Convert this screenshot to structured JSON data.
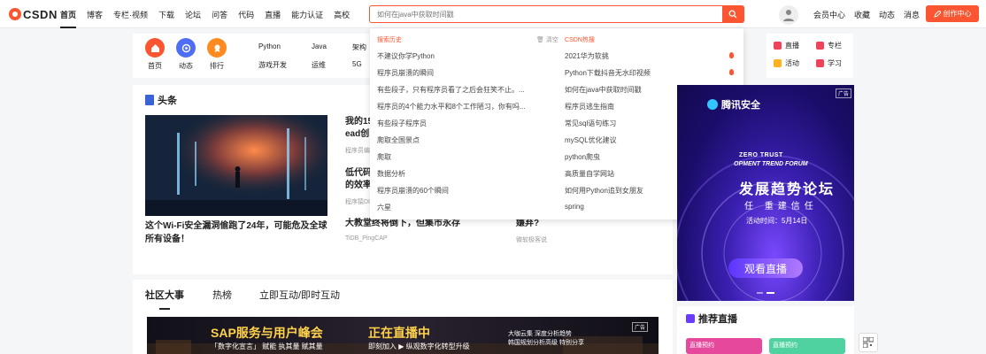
{
  "logo": {
    "text": "CSDN"
  },
  "nav": [
    "首页",
    "博客",
    "专栏·视频",
    "下载",
    "论坛",
    "问答",
    "代码",
    "直播",
    "能力认证",
    "高校"
  ],
  "search": {
    "placeholder": "如何在java中获取时间戳"
  },
  "top_links": [
    "会员中心",
    "收藏",
    "动态",
    "消息"
  ],
  "create_label": "创作中心",
  "quick_icons": [
    {
      "label": "首页",
      "color": "#fc5531"
    },
    {
      "label": "动态",
      "color": "#4f6ef7"
    },
    {
      "label": "排行",
      "color": "#ff8a1f"
    }
  ],
  "quick_tags": [
    "Python",
    "Java",
    "架构",
    "游戏开发",
    "运维",
    "5G"
  ],
  "right_quick": [
    {
      "label": "直播",
      "color": "#f0435a"
    },
    {
      "label": "专栏",
      "color": "#f0435a"
    },
    {
      "label": "活动",
      "color": "#ffb21f"
    },
    {
      "label": "学习",
      "color": "#f0435a"
    }
  ],
  "headline": {
    "title": "头条",
    "image_caption": "这个Wi-Fi安全漏洞偷跑了24年，可能危及全球所有设备！",
    "articles": [
      {
        "title_line1": "我的15",
        "title_line2": "ead创",
        "source": "程序员编"
      },
      {
        "title_line1": "低代码",
        "title_line2": "的效率",
        "source": "程序猿DI"
      },
      {
        "title_line1": "大教堂终将倒下，但集市永存",
        "source": "TiDB_PingCAP"
      },
      {
        "title_line1": "嫌弃?",
        "source": "微软极客说"
      }
    ]
  },
  "dropdown": {
    "history_title": "搜索历史",
    "clear_label": "清空",
    "history": [
      "不建议你学Python",
      "程序员崩溃的瞬间",
      "有些段子，只有程序员看了之后会狂笑不止。...",
      "程序员的4个能力水平和8个工作陋习，你有吗...",
      "有些段子程序员",
      "爬取全国景点",
      "爬取",
      "数据分析",
      "程序员崩溃的60个瞬间",
      "六星"
    ],
    "hot_title": "CSDN热搜",
    "hot": [
      {
        "text": "2021华为软挑",
        "fire": true
      },
      {
        "text": "Python下载抖音无水印视频",
        "fire": true
      },
      {
        "text": "如何在java中获取时间戳",
        "fire": true
      },
      {
        "text": "程序员逃生指南",
        "fire": false
      },
      {
        "text": "常见sql语句练习",
        "fire": false
      },
      {
        "text": "mySQL优化建议",
        "fire": false
      },
      {
        "text": "python爬虫",
        "fire": false
      },
      {
        "text": "高质量自学网站",
        "fire": false
      },
      {
        "text": "如何用Python追到女朋友",
        "fire": false
      },
      {
        "text": "spring",
        "fire": false
      }
    ]
  },
  "ad": {
    "badge": "广告",
    "brand": "腾讯安全",
    "line1": "ZERO TRUST",
    "line2": "OPMENT TREND FORUM",
    "big": "发展趋势论坛",
    "sub": "任 重建信任",
    "date": "活动时间：5月14日",
    "button": "观看直播"
  },
  "community": {
    "tabs": [
      "社区大事",
      "热榜",
      "立即互动/即时互动"
    ],
    "banner": {
      "sap": "SAP服务与用户峰会",
      "live": "正在直播中",
      "s1": "「数字化宣言」 赋能 执其量 赋其量",
      "s2": "即刻加入 ▶ 纵观数字化转型升级",
      "r1": "大咖云集 深度分析趋势",
      "r2": "韩国规划分析高级 特别分享",
      "ad": "广告"
    }
  },
  "recommend": {
    "title": "推荐直播",
    "cards": [
      {
        "label": "直播预约",
        "color": "#e6499b"
      },
      {
        "label": "直播预约",
        "color": "#4fd1a0"
      }
    ]
  }
}
